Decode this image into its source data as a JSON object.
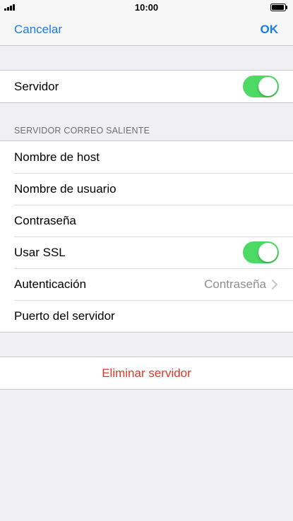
{
  "status_bar": {
    "time": "10:00"
  },
  "nav": {
    "cancel_label": "Cancelar",
    "ok_label": "OK"
  },
  "server_group": {
    "server_label": "Servidor",
    "server_enabled": true
  },
  "outgoing_section": {
    "header": "SERVIDOR CORREO SALIENTE",
    "host_label": "Nombre de host",
    "user_label": "Nombre de usuario",
    "password_label": "Contraseña",
    "ssl_label": "Usar SSL",
    "ssl_enabled": true,
    "auth_label": "Autenticación",
    "auth_value": "Contraseña",
    "port_label": "Puerto del servidor"
  },
  "delete": {
    "label": "Eliminar servidor"
  },
  "colors": {
    "accent": "#1b7bf0",
    "toggle_on": "#4cd964",
    "destructive": "#e0352d",
    "background": "#efeff4"
  }
}
